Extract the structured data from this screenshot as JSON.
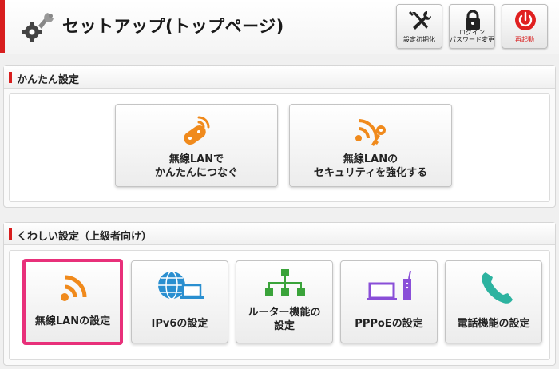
{
  "header": {
    "title": "セットアップ(トップページ)",
    "buttons": {
      "reset_line1": "設定初期化",
      "password_line1": "ログイン",
      "password_line2": "パスワード変更",
      "restart_line1": "再起動"
    }
  },
  "easy": {
    "heading": "かんたん設定",
    "tiles": [
      {
        "line1": "無線LANで",
        "line2": "かんたんにつなぐ"
      },
      {
        "line1": "無線LANの",
        "line2": "セキュリティを強化する"
      }
    ]
  },
  "advanced": {
    "heading": "くわしい設定（上級者向け）",
    "tiles": [
      {
        "line1": "無線LANの設定",
        "line2": ""
      },
      {
        "line1": "IPv6の設定",
        "line2": ""
      },
      {
        "line1": "ルーター機能の",
        "line2": "設定"
      },
      {
        "line1": "PPPoEの設定",
        "line2": ""
      },
      {
        "line1": "電話機能の設定",
        "line2": ""
      }
    ]
  },
  "colors": {
    "accent_red": "#d81e1e",
    "icon_orange": "#f08a1c",
    "selected_pink": "#e8307a",
    "globe_blue": "#2a8fd0",
    "router_green": "#3aa33a",
    "pppoe_purple": "#8a4fd8",
    "phone_teal": "#2db3a0"
  },
  "icons": {
    "logo": "wrench-gear-icon",
    "reset": "tools-cross-icon",
    "password": "lock-icon",
    "restart": "power-icon",
    "easy_connect": "game-controller-wifi-icon",
    "easy_security": "wifi-key-icon",
    "wifi": "wifi-icon",
    "ipv6": "globe-laptop-icon",
    "router": "network-tree-icon",
    "pppoe": "laptop-router-icon",
    "phone": "phone-handset-icon"
  }
}
